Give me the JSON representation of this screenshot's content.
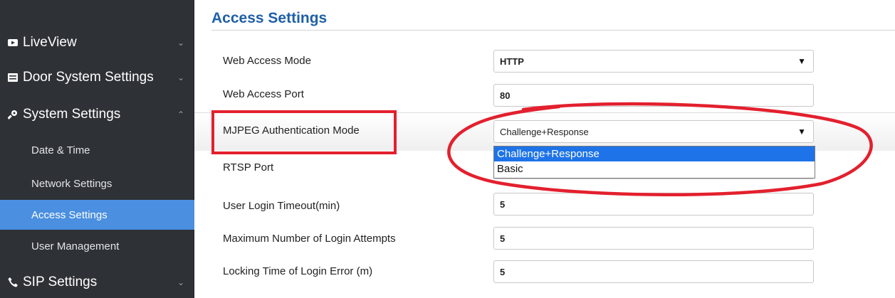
{
  "sidebar": {
    "items": [
      {
        "label": "LiveView",
        "chevron": "⌄"
      },
      {
        "label": "Door System Settings",
        "chevron": "⌄"
      },
      {
        "label": "System Settings",
        "chevron": "⌃"
      },
      {
        "label": "SIP Settings",
        "chevron": "⌄"
      }
    ],
    "sub_items": [
      "Date & Time",
      "Network Settings",
      "Access Settings",
      "User Management"
    ]
  },
  "main": {
    "title": "Access Settings",
    "rows": [
      {
        "label": "Web Access Mode",
        "value": "HTTP",
        "arrow": "▼"
      },
      {
        "label": "Web Access Port",
        "value": "80"
      },
      {
        "label": "MJPEG Authentication Mode",
        "value": "Challenge+Response",
        "arrow": "▼"
      },
      {
        "label": "RTSP Port",
        "value": ""
      },
      {
        "label": "User Login Timeout(min)",
        "value": "5"
      },
      {
        "label": "Maximum Number of Login Attempts",
        "value": "5"
      },
      {
        "label": "Locking Time of Login Error (m)",
        "value": "5"
      }
    ],
    "dropdown_options": [
      "Challenge+Response",
      "Basic"
    ]
  },
  "colors": {
    "sidebar_bg": "#2e3136",
    "active_item": "#4a8fe0",
    "title": "#1f5fa8",
    "annotation_red": "#e3202e",
    "option_selected": "#1e73e8"
  }
}
